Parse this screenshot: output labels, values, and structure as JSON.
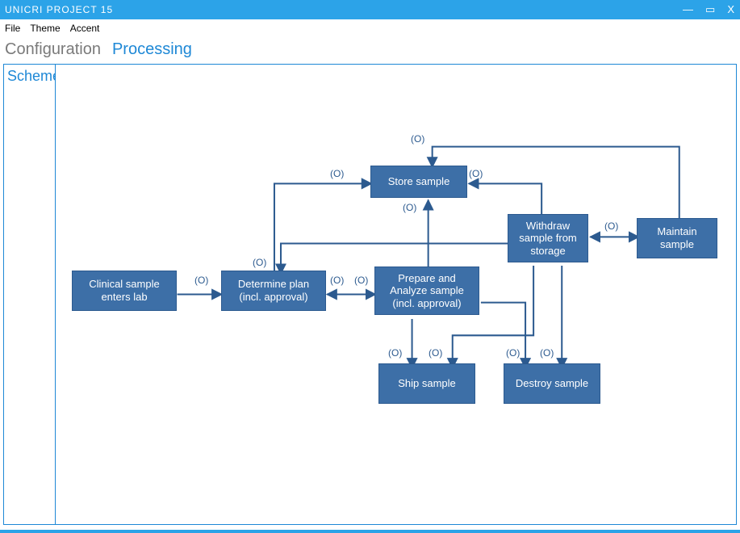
{
  "window": {
    "title": "UNICRI PROJECT 15",
    "controls": {
      "min": "—",
      "max": "▭",
      "close": "X"
    }
  },
  "menubar": [
    "File",
    "Theme",
    "Accent"
  ],
  "main_tabs": [
    {
      "label": "Configuration",
      "active": false
    },
    {
      "label": "Processing",
      "active": true
    }
  ],
  "side_tab": "Scheme",
  "nodes": {
    "clinical": {
      "label": "Clinical sample enters lab"
    },
    "determine": {
      "label": "Determine plan (incl. approval)"
    },
    "prepare": {
      "label": "Prepare and Analyze sample (incl. approval)"
    },
    "store": {
      "label": "Store sample"
    },
    "withdraw": {
      "label": "Withdraw sample from storage"
    },
    "maintain": {
      "label": "Maintain sample"
    },
    "ship": {
      "label": "Ship sample"
    },
    "destroy": {
      "label": "Destroy sample"
    }
  },
  "edge_labels": {
    "l1": "(O)",
    "l2": "(O)",
    "l3": "(O)",
    "l4": "(O)",
    "l5": "(O)",
    "l6": "(O)",
    "l7": "(O)",
    "l8": "(O)",
    "l9": "(O)",
    "l10": "(O)",
    "l11": "(O)",
    "l12": "(O)"
  },
  "chart_data": {
    "type": "flow-diagram",
    "nodes": [
      {
        "id": "clinical",
        "label": "Clinical sample enters lab"
      },
      {
        "id": "determine",
        "label": "Determine plan (incl. approval)"
      },
      {
        "id": "prepare",
        "label": "Prepare and Analyze sample (incl. approval)"
      },
      {
        "id": "store",
        "label": "Store sample"
      },
      {
        "id": "withdraw",
        "label": "Withdraw sample from storage"
      },
      {
        "id": "maintain",
        "label": "Maintain sample"
      },
      {
        "id": "ship",
        "label": "Ship sample"
      },
      {
        "id": "destroy",
        "label": "Destroy sample"
      }
    ],
    "edges": [
      {
        "from": "clinical",
        "to": "determine",
        "label": "(O)"
      },
      {
        "from": "determine",
        "to": "prepare",
        "label": "(O)",
        "bidir": true
      },
      {
        "from": "determine",
        "to": "store",
        "label": "(O)"
      },
      {
        "from": "prepare",
        "to": "store",
        "label": "(O)"
      },
      {
        "from": "store",
        "to": "withdraw",
        "label": "(O)",
        "bidir": true
      },
      {
        "from": "withdraw",
        "to": "maintain",
        "label": "(O)",
        "bidir": true
      },
      {
        "from": "maintain",
        "to": "store",
        "label": "(O)"
      },
      {
        "from": "withdraw",
        "to": "determine",
        "label": "(O)"
      },
      {
        "from": "prepare",
        "to": "ship",
        "label": "(O)"
      },
      {
        "from": "prepare",
        "to": "destroy",
        "label": "(O)"
      },
      {
        "from": "withdraw",
        "to": "ship",
        "label": "(O)"
      },
      {
        "from": "withdraw",
        "to": "destroy",
        "label": "(O)"
      }
    ]
  }
}
